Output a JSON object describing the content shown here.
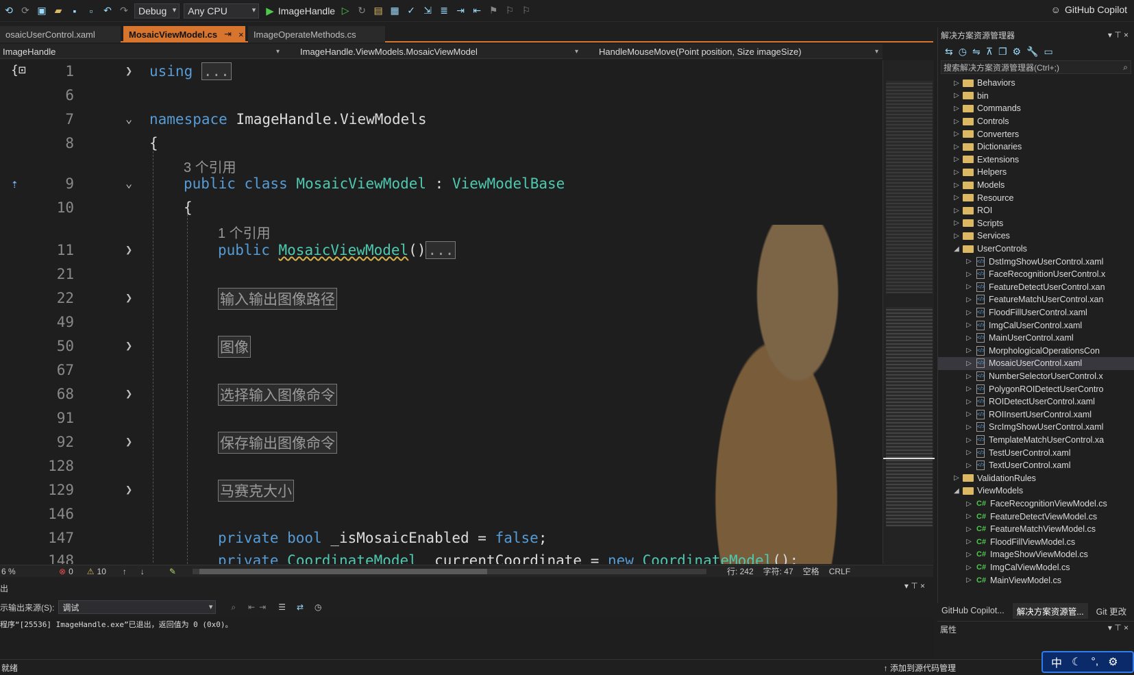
{
  "toolbar": {
    "config": "Debug",
    "platform": "Any CPU",
    "run_target": "ImageHandle",
    "copilot": "GitHub Copilot"
  },
  "tabs": [
    {
      "label": "osaicUserControl.xaml"
    },
    {
      "label": "MosaicViewModel.cs",
      "pin": "⇥",
      "close": "×"
    },
    {
      "label": "ImageOperateMethods.cs"
    }
  ],
  "nav": {
    "project": "ImageHandle",
    "class": "ImageHandle.ViewModels.MosaicViewModel",
    "member": "HandleMouseMove(Point position, Size imageSize)"
  },
  "code": {
    "lines": [
      {
        "num": "1",
        "kw": "using",
        "collapsed": "..."
      },
      {
        "num": "6"
      },
      {
        "num": "7",
        "kw": "namespace",
        "rest": " ImageHandle.ViewModels"
      },
      {
        "num": "8",
        "rest": "{"
      },
      {
        "ref": "3 个引用"
      },
      {
        "num": "9",
        "kw": "public class",
        "ty": "MosaicViewModel",
        "rest": " : ",
        "ty2": "ViewModelBase"
      },
      {
        "num": "10",
        "rest": "{"
      },
      {
        "ref": "1 个引用"
      },
      {
        "num": "11",
        "kw": "public",
        "ty": "MosaicViewModel",
        "rest": "()",
        "collapsed": "..."
      },
      {
        "num": "21"
      },
      {
        "num": "22",
        "region": "输入输出图像路径"
      },
      {
        "num": "49"
      },
      {
        "num": "50",
        "region": "图像"
      },
      {
        "num": "67"
      },
      {
        "num": "68",
        "region": "选择输入图像命令"
      },
      {
        "num": "91"
      },
      {
        "num": "92",
        "region": "保存输出图像命令"
      },
      {
        "num": "128"
      },
      {
        "num": "129",
        "region": "马赛克大小"
      },
      {
        "num": "146"
      },
      {
        "num": "147",
        "kw": "private bool",
        "rest": " _isMosaicEnabled = ",
        "kw2": "false",
        "rest2": ";"
      },
      {
        "num": "148",
        "kw": "private",
        "ty": "CoordinateModel",
        "rest": " _currentCoordinate = ",
        "kw2": "new",
        "ty2": "CoordinateModel",
        "rest2": "();"
      }
    ]
  },
  "editor_status": {
    "zoom": "6 %",
    "errors": "0",
    "warnings": "10",
    "line": "行: 242",
    "col": "字符: 47",
    "spaces": "空格",
    "eol": "CRLF"
  },
  "output": {
    "title": "出",
    "source_label": "示输出来源(S):",
    "source_value": "调试",
    "text": "程序“[25536] ImageHandle.exe”已退出，返回值为 0 (0x0)。"
  },
  "statusbar": {
    "ready": "就绪",
    "source_control": "添加到源代码管理"
  },
  "solution_explorer": {
    "title": "解决方案资源管理器",
    "search_placeholder": "搜索解决方案资源管理器(Ctrl+;)",
    "items": [
      {
        "label": "Behaviors",
        "type": "folder",
        "level": 0,
        "exp": "▷"
      },
      {
        "label": "bin",
        "type": "folder",
        "level": 0,
        "exp": "▷"
      },
      {
        "label": "Commands",
        "type": "folder",
        "level": 0,
        "exp": "▷"
      },
      {
        "label": "Controls",
        "type": "folder",
        "level": 0,
        "exp": "▷"
      },
      {
        "label": "Converters",
        "type": "folder",
        "level": 0,
        "exp": "▷"
      },
      {
        "label": "Dictionaries",
        "type": "folder",
        "level": 0,
        "exp": "▷"
      },
      {
        "label": "Extensions",
        "type": "folder",
        "level": 0,
        "exp": "▷"
      },
      {
        "label": "Helpers",
        "type": "folder",
        "level": 0,
        "exp": "▷"
      },
      {
        "label": "Models",
        "type": "folder",
        "level": 0,
        "exp": "▷"
      },
      {
        "label": "Resource",
        "type": "folder",
        "level": 0,
        "exp": "▷"
      },
      {
        "label": "ROI",
        "type": "folder",
        "level": 0,
        "exp": "▷"
      },
      {
        "label": "Scripts",
        "type": "folder",
        "level": 0,
        "exp": "▷"
      },
      {
        "label": "Services",
        "type": "folder",
        "level": 0,
        "exp": "▷"
      },
      {
        "label": "UserControls",
        "type": "folder",
        "level": 0,
        "exp": "◢"
      },
      {
        "label": "DstImgShowUserControl.xaml",
        "type": "xaml",
        "level": 1,
        "exp": "▷"
      },
      {
        "label": "FaceRecognitionUserControl.x",
        "type": "xaml",
        "level": 1,
        "exp": "▷"
      },
      {
        "label": "FeatureDetectUserControl.xan",
        "type": "xaml",
        "level": 1,
        "exp": "▷"
      },
      {
        "label": "FeatureMatchUserControl.xan",
        "type": "xaml",
        "level": 1,
        "exp": "▷"
      },
      {
        "label": "FloodFillUserControl.xaml",
        "type": "xaml",
        "level": 1,
        "exp": "▷"
      },
      {
        "label": "ImgCalUserControl.xaml",
        "type": "xaml",
        "level": 1,
        "exp": "▷"
      },
      {
        "label": "MainUserControl.xaml",
        "type": "xaml",
        "level": 1,
        "exp": "▷"
      },
      {
        "label": "MorphologicalOperationsCon",
        "type": "xaml",
        "level": 1,
        "exp": "▷"
      },
      {
        "label": "MosaicUserControl.xaml",
        "type": "xaml",
        "level": 1,
        "exp": "▷",
        "selected": true
      },
      {
        "label": "NumberSelectorUserControl.x",
        "type": "xaml",
        "level": 1,
        "exp": "▷"
      },
      {
        "label": "PolygonROIDetectUserContro",
        "type": "xaml",
        "level": 1,
        "exp": "▷"
      },
      {
        "label": "ROIDetectUserControl.xaml",
        "type": "xaml",
        "level": 1,
        "exp": "▷"
      },
      {
        "label": "ROIInsertUserControl.xaml",
        "type": "xaml",
        "level": 1,
        "exp": "▷"
      },
      {
        "label": "SrcImgShowUserControl.xaml",
        "type": "xaml",
        "level": 1,
        "exp": "▷"
      },
      {
        "label": "TemplateMatchUserControl.xa",
        "type": "xaml",
        "level": 1,
        "exp": "▷"
      },
      {
        "label": "TestUserControl.xaml",
        "type": "xaml",
        "level": 1,
        "exp": "▷"
      },
      {
        "label": "TextUserControl.xaml",
        "type": "xaml",
        "level": 1,
        "exp": "▷"
      },
      {
        "label": "ValidationRules",
        "type": "folder",
        "level": 0,
        "exp": "▷"
      },
      {
        "label": "ViewModels",
        "type": "folder",
        "level": 0,
        "exp": "◢"
      },
      {
        "label": "FaceRecognitionViewModel.cs",
        "type": "cs",
        "level": 1,
        "exp": "▷"
      },
      {
        "label": "FeatureDetectViewModel.cs",
        "type": "cs",
        "level": 1,
        "exp": "▷"
      },
      {
        "label": "FeatureMatchViewModel.cs",
        "type": "cs",
        "level": 1,
        "exp": "▷"
      },
      {
        "label": "FloodFillViewModel.cs",
        "type": "cs",
        "level": 1,
        "exp": "▷"
      },
      {
        "label": "ImageShowViewModel.cs",
        "type": "cs",
        "level": 1,
        "exp": "▷"
      },
      {
        "label": "ImgCalViewModel.cs",
        "type": "cs",
        "level": 1,
        "exp": "▷"
      },
      {
        "label": "MainViewModel.cs",
        "type": "cs",
        "level": 1,
        "exp": "▷"
      }
    ],
    "bottom_tabs": [
      "GitHub Copilot...",
      "解决方案资源管...",
      "Git 更改"
    ]
  },
  "properties": {
    "title": "属性"
  },
  "ime": {
    "lang": "中"
  }
}
